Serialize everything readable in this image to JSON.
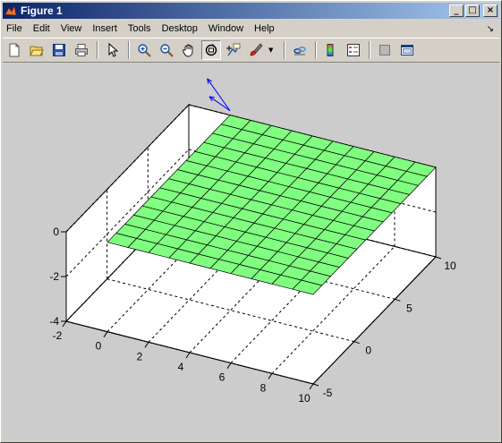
{
  "window": {
    "title": "Figure 1",
    "controls": {
      "minimize": "_",
      "maximize": "□",
      "close": "×"
    }
  },
  "menubar": {
    "items": [
      "File",
      "Edit",
      "View",
      "Insert",
      "Tools",
      "Desktop",
      "Window",
      "Help"
    ],
    "dock_arrow": "↘"
  },
  "toolbar": {
    "tools": [
      {
        "name": "new-figure-icon"
      },
      {
        "name": "open-file-icon"
      },
      {
        "name": "save-icon"
      },
      {
        "name": "print-icon"
      },
      {
        "sep": true
      },
      {
        "name": "edit-plot-arrow-icon"
      },
      {
        "sep": true
      },
      {
        "name": "zoom-in-icon"
      },
      {
        "name": "zoom-out-icon"
      },
      {
        "name": "pan-hand-icon"
      },
      {
        "name": "rotate-3d-icon",
        "pressed": true
      },
      {
        "name": "data-cursor-icon"
      },
      {
        "name": "brush-icon"
      },
      {
        "dropdown": true
      },
      {
        "sep": true
      },
      {
        "name": "link-plot-icon"
      },
      {
        "sep": true
      },
      {
        "name": "colorbar-icon"
      },
      {
        "name": "legend-icon"
      },
      {
        "sep": true
      },
      {
        "name": "hide-plot-tools-icon"
      },
      {
        "name": "show-plot-tools-icon"
      }
    ]
  },
  "chart_data": {
    "type": "surface",
    "view": "3d",
    "grid": true,
    "xlim": [
      -2,
      10
    ],
    "ylim": [
      -5,
      10
    ],
    "zlim": [
      -4,
      0
    ],
    "x_ticks": [
      "-2",
      "0",
      "2",
      "4",
      "6",
      "8",
      "10"
    ],
    "y_ticks": [
      "-5",
      "0",
      "5",
      "10"
    ],
    "z_ticks": [
      "-4",
      "-2",
      "0"
    ],
    "surface": {
      "x_range": [
        0,
        10
      ],
      "y_range": [
        -5,
        10
      ],
      "z_value": 0,
      "mesh": [
        10,
        14
      ],
      "face_color": "#80ff80",
      "edge_color": "#000000"
    },
    "quiver": {
      "color": "#0000ff",
      "arrows": [
        {
          "from": [
            0,
            10,
            0.2
          ],
          "to": [
            -1,
            10,
            0.6
          ]
        },
        {
          "from": [
            0,
            10,
            0.2
          ],
          "to": [
            -1.5,
            11,
            0.9
          ]
        }
      ]
    },
    "colors": {
      "background": "#cccccc",
      "axes": "#ffffff"
    }
  }
}
